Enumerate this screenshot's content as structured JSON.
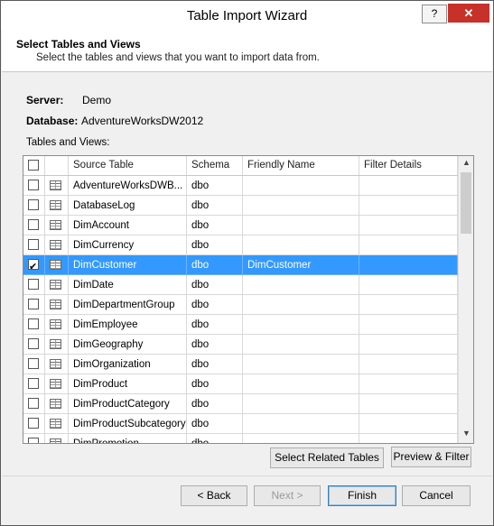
{
  "window": {
    "title": "Table Import Wizard",
    "help_label": "?",
    "close_label": "✕"
  },
  "header": {
    "title": "Select Tables and Views",
    "subtitle": "Select the tables and views that you want to import data from."
  },
  "connection": {
    "server_label": "Server:",
    "server_value": "Demo",
    "database_label": "Database:",
    "database_value": "AdventureWorksDW2012",
    "list_label": "Tables and Views:"
  },
  "grid": {
    "columns": [
      "Source Table",
      "Schema",
      "Friendly Name",
      "Filter Details"
    ],
    "rows": [
      {
        "checked": false,
        "source": "AdventureWorksDWB...",
        "schema": "dbo",
        "friendly": "",
        "filter": "",
        "selected": false
      },
      {
        "checked": false,
        "source": "DatabaseLog",
        "schema": "dbo",
        "friendly": "",
        "filter": "",
        "selected": false
      },
      {
        "checked": false,
        "source": "DimAccount",
        "schema": "dbo",
        "friendly": "",
        "filter": "",
        "selected": false
      },
      {
        "checked": false,
        "source": "DimCurrency",
        "schema": "dbo",
        "friendly": "",
        "filter": "",
        "selected": false
      },
      {
        "checked": true,
        "source": "DimCustomer",
        "schema": "dbo",
        "friendly": "DimCustomer",
        "filter": "",
        "selected": true
      },
      {
        "checked": false,
        "source": "DimDate",
        "schema": "dbo",
        "friendly": "",
        "filter": "",
        "selected": false
      },
      {
        "checked": false,
        "source": "DimDepartmentGroup",
        "schema": "dbo",
        "friendly": "",
        "filter": "",
        "selected": false
      },
      {
        "checked": false,
        "source": "DimEmployee",
        "schema": "dbo",
        "friendly": "",
        "filter": "",
        "selected": false
      },
      {
        "checked": false,
        "source": "DimGeography",
        "schema": "dbo",
        "friendly": "",
        "filter": "",
        "selected": false
      },
      {
        "checked": false,
        "source": "DimOrganization",
        "schema": "dbo",
        "friendly": "",
        "filter": "",
        "selected": false
      },
      {
        "checked": false,
        "source": "DimProduct",
        "schema": "dbo",
        "friendly": "",
        "filter": "",
        "selected": false
      },
      {
        "checked": false,
        "source": "DimProductCategory",
        "schema": "dbo",
        "friendly": "",
        "filter": "",
        "selected": false
      },
      {
        "checked": false,
        "source": "DimProductSubcategory",
        "schema": "dbo",
        "friendly": "",
        "filter": "",
        "selected": false
      },
      {
        "checked": false,
        "source": "DimPromotion",
        "schema": "dbo",
        "friendly": "",
        "filter": "",
        "selected": false
      }
    ],
    "scroll_up_label": "▲",
    "scroll_down_label": "▼"
  },
  "actions": {
    "related_label": "Select Related Tables",
    "preview_label": "Preview & Filter"
  },
  "footer": {
    "back_label": "< Back",
    "next_label": "Next >",
    "finish_label": "Finish",
    "cancel_label": "Cancel"
  }
}
